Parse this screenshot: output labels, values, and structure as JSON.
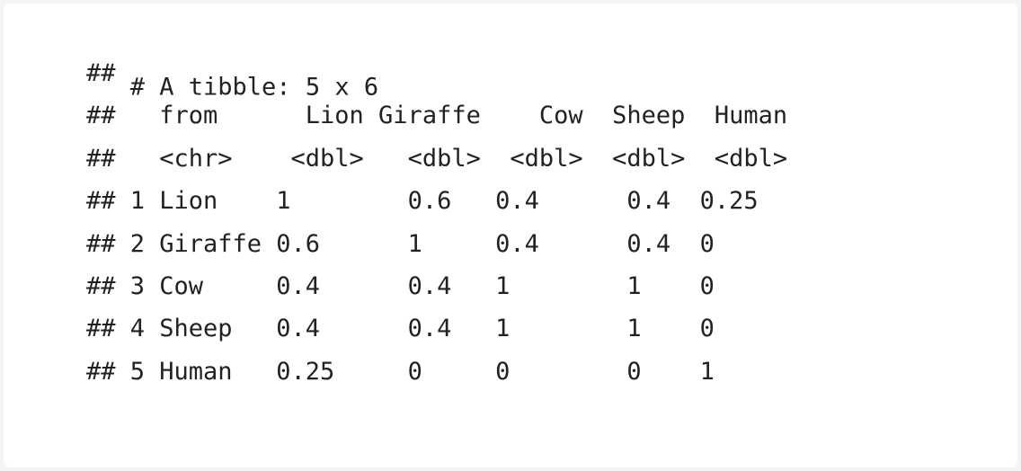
{
  "console": {
    "prompt": "##",
    "header_line": "# A tibble: 5 x 6",
    "columns": [
      {
        "name": "from",
        "type": "<chr>"
      },
      {
        "name": "Lion",
        "type": "<dbl>"
      },
      {
        "name": "Giraffe",
        "type": "<dbl>"
      },
      {
        "name": "Cow",
        "type": "<dbl>"
      },
      {
        "name": "Sheep",
        "type": "<dbl>"
      },
      {
        "name": "Human",
        "type": "<dbl>"
      }
    ],
    "rows": [
      {
        "index": "1",
        "from": "Lion",
        "Lion": "1",
        "Giraffe": "0.6",
        "Cow": "0.4",
        "Sheep": "0.4",
        "Human": "0.25"
      },
      {
        "index": "2",
        "from": "Giraffe",
        "Lion": "0.6",
        "Giraffe": "1",
        "Cow": "0.4",
        "Sheep": "0.4",
        "Human": "0"
      },
      {
        "index": "3",
        "from": "Cow",
        "Lion": "0.4",
        "Giraffe": "0.4",
        "Cow": "1",
        "Sheep": "1",
        "Human": "0"
      },
      {
        "index": "4",
        "from": "Sheep",
        "Lion": "0.4",
        "Giraffe": "0.4",
        "Cow": "1",
        "Sheep": "1",
        "Human": "0"
      },
      {
        "index": "5",
        "from": "Human",
        "Lion": "0.25",
        "Giraffe": "0",
        "Cow": "0",
        "Sheep": "0",
        "Human": "1"
      }
    ]
  }
}
